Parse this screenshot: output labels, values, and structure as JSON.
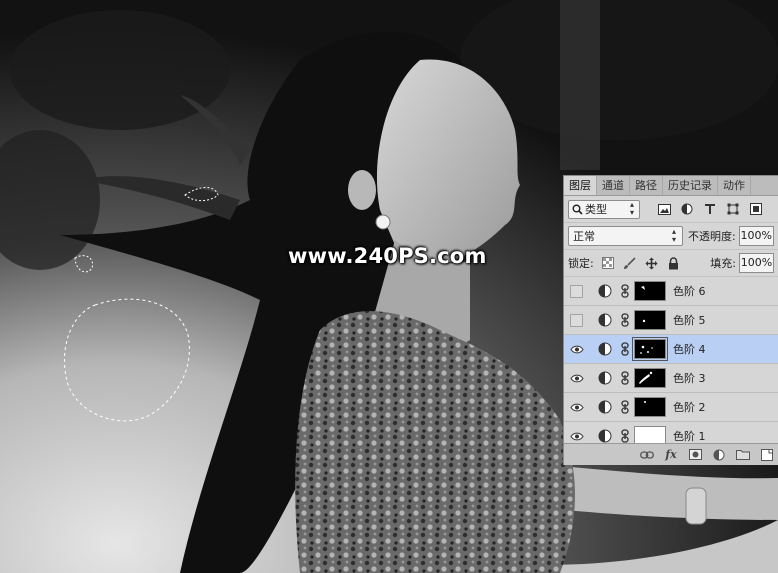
{
  "canvas": {
    "watermark": "www.240PS.com"
  },
  "panel": {
    "tabs": [
      {
        "label": "图层",
        "active": true
      },
      {
        "label": "通道",
        "active": false
      },
      {
        "label": "路径",
        "active": false
      },
      {
        "label": "历史记录",
        "active": false
      },
      {
        "label": "动作",
        "active": false
      }
    ],
    "filter": {
      "selected": "类型",
      "icons": [
        "image-filter-icon",
        "adjustment-filter-icon",
        "type-filter-icon",
        "shape-filter-icon",
        "smart-object-filter-icon"
      ]
    },
    "blend": {
      "mode": "正常",
      "opacity_label": "不透明度:",
      "opacity_value": "100%"
    },
    "lock": {
      "label": "锁定:",
      "fill_label": "填充:",
      "fill_value": "100%"
    },
    "layers": [
      {
        "name": "色阶 6",
        "visible": false,
        "selected": false,
        "mask": "black"
      },
      {
        "name": "色阶 5",
        "visible": false,
        "selected": false,
        "mask": "black"
      },
      {
        "name": "色阶 4",
        "visible": true,
        "selected": true,
        "mask": "black"
      },
      {
        "name": "色阶 3",
        "visible": true,
        "selected": false,
        "mask": "black"
      },
      {
        "name": "色阶 2",
        "visible": true,
        "selected": false,
        "mask": "black"
      },
      {
        "name": "色阶 1",
        "visible": true,
        "selected": false,
        "mask": "white"
      }
    ],
    "bottom_icons": [
      "link-layers-icon",
      "fx-icon",
      "add-mask-icon",
      "new-adjustment-icon",
      "new-group-icon",
      "new-layer-icon"
    ],
    "fx_label": "fx"
  },
  "colors": {
    "panel_bg": "#d6d6d6",
    "selected_layer": "#b9cff3",
    "tab_bar": "#bcbcbc"
  }
}
